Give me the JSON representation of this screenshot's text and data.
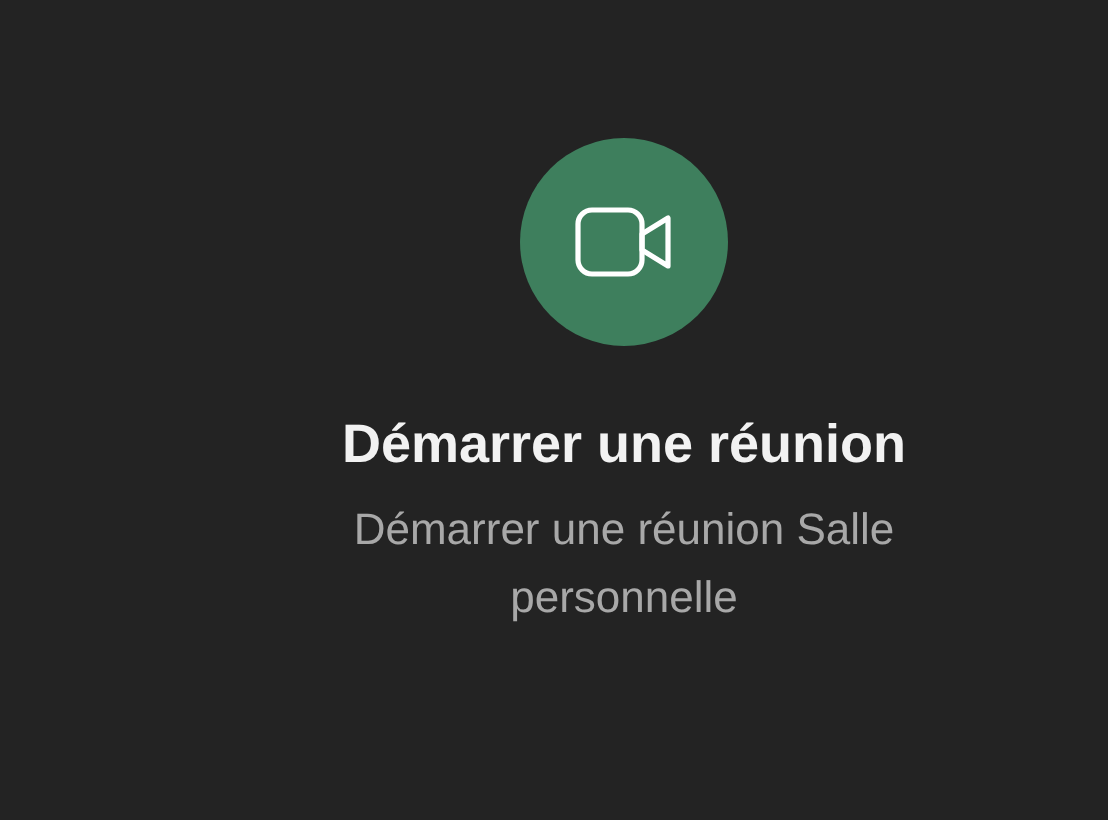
{
  "action": {
    "title": "Démarrer une réunion",
    "subtitle": "Démarrer une réunion Salle personnelle"
  }
}
